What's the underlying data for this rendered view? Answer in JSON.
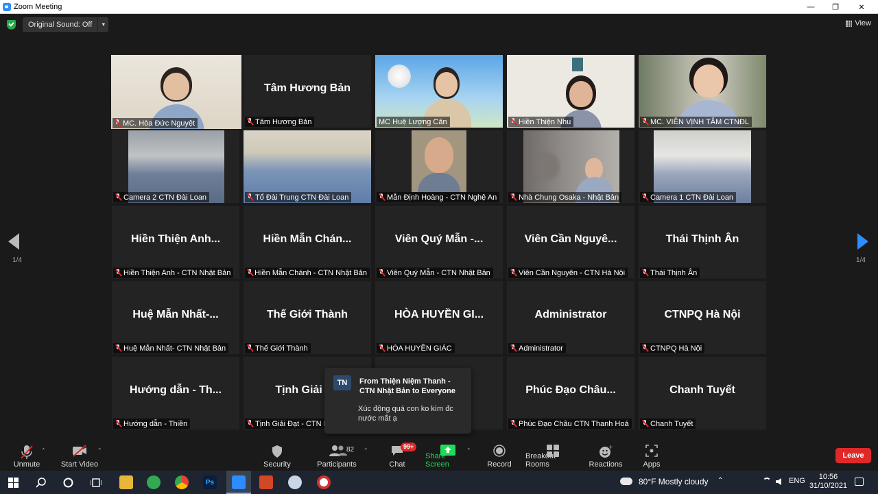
{
  "window": {
    "title": "Zoom Meeting",
    "minimize": "—",
    "maximize": "❐",
    "close": "✕"
  },
  "topbar": {
    "original_sound": "Original Sound: Off",
    "view": "View"
  },
  "tiles": [
    {
      "label": "MC. Hòa Đức Nguyệt",
      "name": ""
    },
    {
      "label": "Tâm Hương Bản",
      "name": "Tâm Hương Bản"
    },
    {
      "label": "MC Huệ Lượng Căn",
      "name": ""
    },
    {
      "label": "Hiền Thiện Nhu",
      "name": ""
    },
    {
      "label": "MC. VIÊN VỊNH TÂM CTNĐL",
      "name": ""
    },
    {
      "label": "Camera 2 CTN Đài Loan",
      "name": ""
    },
    {
      "label": "Tổ Đài Trung CTN Đài Loan",
      "name": ""
    },
    {
      "label": "Mẫn Định Hoàng - CTN Nghệ An",
      "name": ""
    },
    {
      "label": "Nhà Chung Osaka - Nhật Bản",
      "name": ""
    },
    {
      "label": "Camera 1 CTN Đài Loan",
      "name": ""
    },
    {
      "label": "Hiền Thiện Anh - CTN Nhật Bản",
      "name": "Hiền Thiện Anh..."
    },
    {
      "label": "Hiền Mẫn Chánh - CTN Nhật Bản",
      "name": "Hiền Mẫn Chán..."
    },
    {
      "label": "Viên Quý Mẫn - CTN Nhật Bản",
      "name": "Viên Quý Mẫn -..."
    },
    {
      "label": "Viên Cần Nguyên - CTN Hà Nội",
      "name": "Viên Cần Nguyê..."
    },
    {
      "label": "Thái Thịnh Ân",
      "name": "Thái Thịnh Ân"
    },
    {
      "label": "Huệ Mẫn Nhất- CTN Nhật Bản",
      "name": "Huệ Mẫn Nhất-..."
    },
    {
      "label": "Thế Giới Thành",
      "name": "Thế Giới Thành"
    },
    {
      "label": "HÒA HUYỀN GIÁC",
      "name": "HÒA HUYỀN GI..."
    },
    {
      "label": "Administrator",
      "name": "Administrator"
    },
    {
      "label": "CTNPQ Hà Nội",
      "name": "CTNPQ Hà Nội"
    },
    {
      "label": "Hướng dẫn - Thiền",
      "name": "Hướng dẫn - Th..."
    },
    {
      "label": "Tịnh Giải Đạt - CTN H",
      "name": "Tịnh Giải Đạ"
    },
    {
      "label": "",
      "name": ""
    },
    {
      "label": "Phúc Đạo Châu CTN Thanh Hoá",
      "name": "Phúc Đạo Châu..."
    },
    {
      "label": "Chanh Tuyết",
      "name": "Chanh Tuyết"
    }
  ],
  "pager": {
    "left": "1/4",
    "right": "1/4"
  },
  "chat_popup": {
    "avatar": "TN",
    "from": "From Thiện Niệm Thanh - CTN Nhật Bản to Everyone",
    "message": "Xúc động quá con ko kìm đc nước mắt ạ"
  },
  "toolbar": {
    "unmute": "Unmute",
    "start_video": "Start Video",
    "security": "Security",
    "participants": "Participants",
    "participants_count": "82",
    "chat": "Chat",
    "chat_badge": "99+",
    "share_screen": "Share Screen",
    "record": "Record",
    "breakout_rooms": "Breakout Rooms",
    "reactions": "Reactions",
    "apps": "Apps",
    "leave": "Leave"
  },
  "taskbar": {
    "weather": "80°F  Mostly cloudy",
    "lang": "ENG",
    "time": "10:56",
    "date": "31/10/2021",
    "ps_label": "Ps"
  },
  "colors": {
    "accent_green": "#23a94c",
    "active_speaker": "#c8e03a",
    "leave_red": "#e02828",
    "share_green": "#23d959",
    "nav_blue": "#2d8cff"
  }
}
